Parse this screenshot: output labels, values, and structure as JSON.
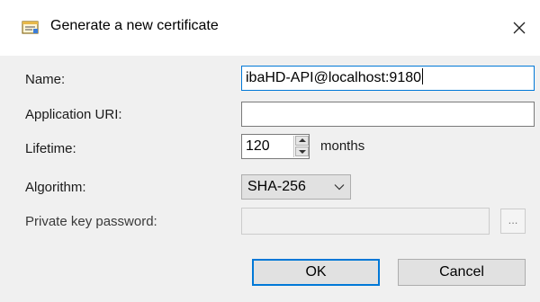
{
  "dialog": {
    "title": "Generate a new certificate",
    "icon": "certificate-form-icon",
    "close_icon": "close-icon"
  },
  "form": {
    "name_label": "Name:",
    "name_value": "ibaHD-API@localhost:9180",
    "app_uri_label": "Application URI:",
    "app_uri_value": "",
    "lifetime_label": "Lifetime:",
    "lifetime_value": "120",
    "lifetime_unit": "months",
    "algorithm_label": "Algorithm:",
    "algorithm_value": "SHA-256",
    "private_key_label": "Private key password:",
    "private_key_value": "",
    "browse_label": "..."
  },
  "buttons": {
    "ok": "OK",
    "cancel": "Cancel"
  },
  "colors": {
    "focus_accent": "#0078d7"
  }
}
